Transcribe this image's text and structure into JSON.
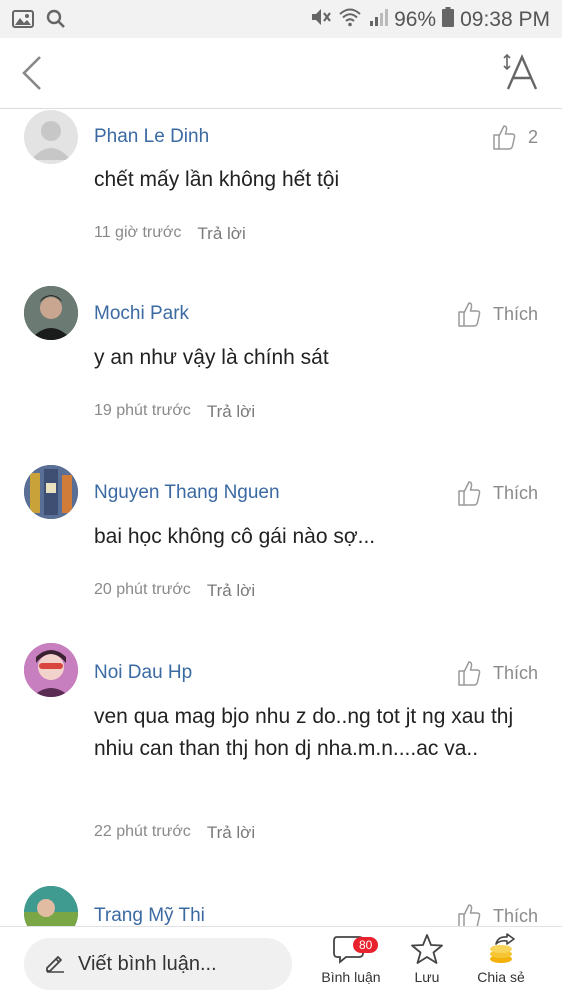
{
  "status_bar": {
    "battery": "96%",
    "time": "09:38 PM"
  },
  "header": {
    "back_icon": "chevron-left-icon",
    "font_icon": "font-size-icon"
  },
  "comments": [
    {
      "author": "Phan Le Dinh",
      "text": "chết mấy lần không hết tội",
      "time": "11 giờ trước",
      "reply": "Trả lời",
      "like": "2"
    },
    {
      "author": "Mochi Park",
      "text": "y an như vậy là chính sát",
      "time": "19 phút trước",
      "reply": "Trả lời",
      "like": "Thích"
    },
    {
      "author": "Nguyen Thang Nguen",
      "text": "bai học không cô gái nào sợ...",
      "time": "20 phút trước",
      "reply": "Trả lời",
      "like": "Thích"
    },
    {
      "author": "Noi Dau Hp",
      "text": "ven qua mag bjo nhu z do..ng tot jt ng xau thj nhiu can than thj hon dj nha.m.n....ac va..",
      "time": "22 phút trước",
      "reply": "Trả lời",
      "like": "Thích"
    },
    {
      "author": "Trang Mỹ Thi",
      "text": "",
      "time": "",
      "reply": "",
      "like": "Thích"
    }
  ],
  "bottom_bar": {
    "compose_placeholder": "Viết bình luận...",
    "comments_label": "Bình luận",
    "comments_count": "80",
    "save_label": "Lưu",
    "share_label": "Chia sẻ"
  },
  "colors": {
    "author": "#3b6aa3",
    "badge": "#e8232d",
    "muted": "#8a8a8a"
  }
}
